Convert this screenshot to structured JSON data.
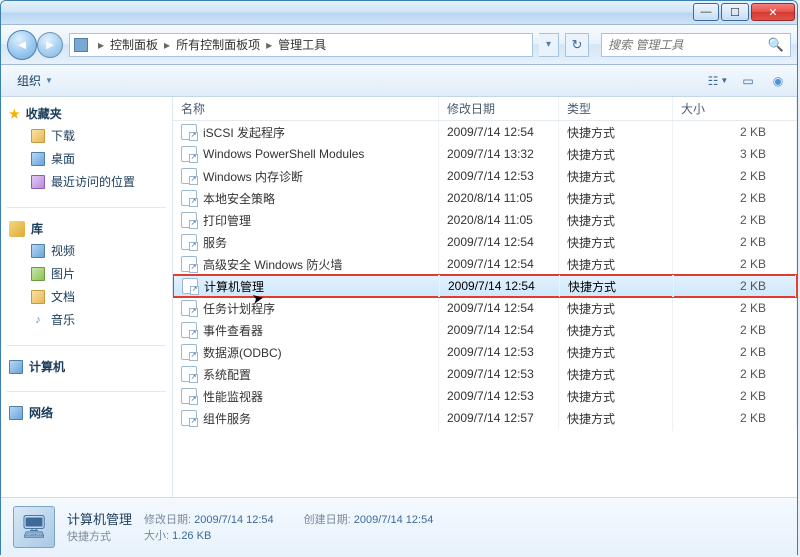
{
  "breadcrumbs": [
    "控制面板",
    "所有控制面板项",
    "管理工具"
  ],
  "search": {
    "placeholder": "搜索 管理工具"
  },
  "toolbar": {
    "organize": "组织"
  },
  "sidebar": {
    "favorites": {
      "label": "收藏夹",
      "items": [
        "下载",
        "桌面",
        "最近访问的位置"
      ]
    },
    "libraries": {
      "label": "库",
      "items": [
        "视频",
        "图片",
        "文档",
        "音乐"
      ]
    },
    "computer": {
      "label": "计算机"
    },
    "network": {
      "label": "网络"
    }
  },
  "columns": {
    "name": "名称",
    "date": "修改日期",
    "type": "类型",
    "size": "大小"
  },
  "rows": [
    {
      "name": "iSCSI 发起程序",
      "date": "2009/7/14 12:54",
      "type": "快捷方式",
      "size": "2 KB"
    },
    {
      "name": "Windows PowerShell Modules",
      "date": "2009/7/14 13:32",
      "type": "快捷方式",
      "size": "3 KB"
    },
    {
      "name": "Windows 内存诊断",
      "date": "2009/7/14 12:53",
      "type": "快捷方式",
      "size": "2 KB"
    },
    {
      "name": "本地安全策略",
      "date": "2020/8/14 11:05",
      "type": "快捷方式",
      "size": "2 KB"
    },
    {
      "name": "打印管理",
      "date": "2020/8/14 11:05",
      "type": "快捷方式",
      "size": "2 KB"
    },
    {
      "name": "服务",
      "date": "2009/7/14 12:54",
      "type": "快捷方式",
      "size": "2 KB"
    },
    {
      "name": "高级安全 Windows 防火墙",
      "date": "2009/7/14 12:54",
      "type": "快捷方式",
      "size": "2 KB"
    },
    {
      "name": "计算机管理",
      "date": "2009/7/14 12:54",
      "type": "快捷方式",
      "size": "2 KB",
      "selected": true
    },
    {
      "name": "任务计划程序",
      "date": "2009/7/14 12:54",
      "type": "快捷方式",
      "size": "2 KB"
    },
    {
      "name": "事件查看器",
      "date": "2009/7/14 12:54",
      "type": "快捷方式",
      "size": "2 KB"
    },
    {
      "name": "数据源(ODBC)",
      "date": "2009/7/14 12:53",
      "type": "快捷方式",
      "size": "2 KB"
    },
    {
      "name": "系统配置",
      "date": "2009/7/14 12:53",
      "type": "快捷方式",
      "size": "2 KB"
    },
    {
      "name": "性能监视器",
      "date": "2009/7/14 12:53",
      "type": "快捷方式",
      "size": "2 KB"
    },
    {
      "name": "组件服务",
      "date": "2009/7/14 12:57",
      "type": "快捷方式",
      "size": "2 KB"
    }
  ],
  "details": {
    "title": "计算机管理",
    "type": "快捷方式",
    "mod_label": "修改日期:",
    "mod_value": "2009/7/14 12:54",
    "create_label": "创建日期:",
    "create_value": "2009/7/14 12:54",
    "size_label": "大小:",
    "size_value": "1.26 KB"
  }
}
